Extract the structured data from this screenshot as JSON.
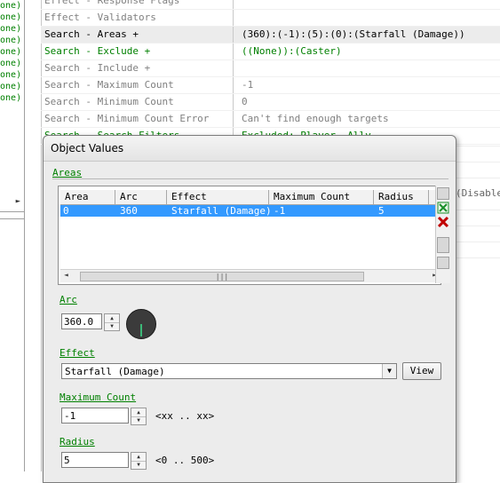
{
  "left_list": [
    "None)",
    "None)",
    "None)",
    "None)",
    "None)",
    "None)",
    "None)",
    "None)",
    "None)"
  ],
  "left_scroll_arrow": "►",
  "properties": [
    {
      "name": "Effect - Response Flags",
      "value": "",
      "name_color": "gray",
      "value_color": "gray"
    },
    {
      "name": "Effect - Validators",
      "value": "",
      "name_color": "gray",
      "value_color": "gray"
    },
    {
      "name": "Search - Areas +",
      "value": "(360):(-1):(5):(0):(Starfall (Damage))",
      "name_color": "black",
      "value_color": "black",
      "selected": true
    },
    {
      "name": "Search - Exclude +",
      "value": "((None)):(Caster)",
      "name_color": "green",
      "value_color": "green"
    },
    {
      "name": "Search - Include +",
      "value": "",
      "name_color": "gray",
      "value_color": "gray"
    },
    {
      "name": "Search - Maximum Count",
      "value": "-1",
      "name_color": "gray",
      "value_color": "gray"
    },
    {
      "name": "Search - Minimum Count",
      "value": "0",
      "name_color": "gray",
      "value_color": "gray"
    },
    {
      "name": "Search - Minimum Count Error",
      "value": "Can't find enough targets",
      "name_color": "gray",
      "value_color": "gray"
    },
    {
      "name": "Search - Search Filters",
      "value": "Excluded: Player, Ally",
      "name_color": "green",
      "value_color": "green"
    }
  ],
  "disabled_fragment": "(Disabled",
  "dialog": {
    "title": "Object Values",
    "areas_label": "Areas",
    "columns": [
      "Area",
      "Arc",
      "Effect",
      "Maximum Count",
      "Radius"
    ],
    "rows": [
      {
        "area": "0",
        "arc": "360",
        "effect": "Starfall (Damage)",
        "max_count": "-1",
        "radius": "5"
      }
    ],
    "hscroll_grip": "|||",
    "arc_label": "Arc",
    "arc_value": "360.0",
    "effect_label": "Effect",
    "effect_value": "Starfall (Damage)",
    "view_button": "View",
    "max_count_label": "Maximum Count",
    "max_count_value": "-1",
    "max_count_range": "<xx .. xx>",
    "radius_label": "Radius",
    "radius_value": "5",
    "radius_range": "<0 .. 500>"
  },
  "icons": {
    "add": "add-icon",
    "delete": "delete-icon",
    "spin_up": "▲",
    "spin_down": "▼",
    "dropdown": "▼",
    "scroll_left": "◄",
    "scroll_right": "►"
  },
  "colors": {
    "selection": "#3399ff",
    "green_text": "#008000",
    "gray_text": "#808080",
    "add_icon": "#1a8f2a",
    "delete_icon": "#c00000"
  }
}
